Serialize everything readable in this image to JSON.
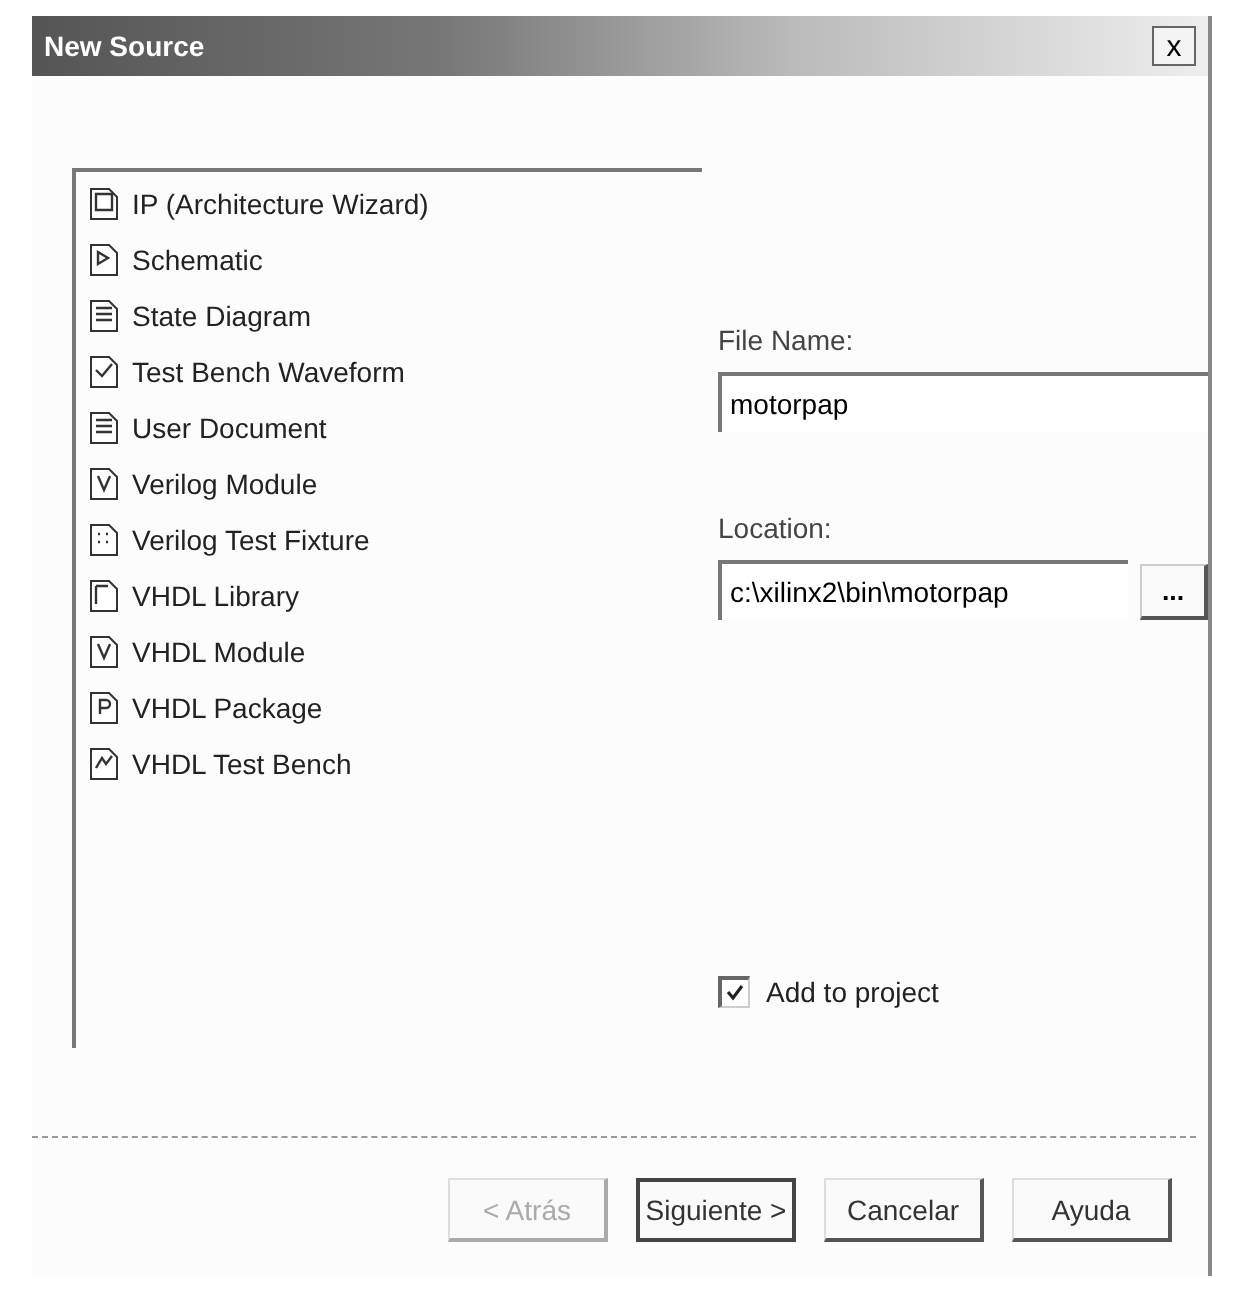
{
  "window": {
    "title": "New Source",
    "close": "x"
  },
  "source_types": [
    {
      "label": "IP (Architecture Wizard)",
      "kind": "ip"
    },
    {
      "label": "Schematic",
      "kind": "schematic"
    },
    {
      "label": "State Diagram",
      "kind": "lines"
    },
    {
      "label": "Test Bench Waveform",
      "kind": "check"
    },
    {
      "label": "User Document",
      "kind": "lines"
    },
    {
      "label": "Verilog Module",
      "kind": "v"
    },
    {
      "label": "Verilog Test Fixture",
      "kind": "dots"
    },
    {
      "label": "VHDL Library",
      "kind": "library"
    },
    {
      "label": "VHDL Module",
      "kind": "v"
    },
    {
      "label": "VHDL Package",
      "kind": "p"
    },
    {
      "label": "VHDL Test Bench",
      "kind": "bench"
    }
  ],
  "file_name": {
    "label": "File Name:",
    "value": "motorpap"
  },
  "location": {
    "label": "Location:",
    "value": "c:\\xilinx2\\bin\\motorpap",
    "browse": "..."
  },
  "add_to_project": {
    "label": "Add to project",
    "checked": true
  },
  "buttons": [
    {
      "label": "< Atrás",
      "disabled": true,
      "default": false
    },
    {
      "label": "Siguiente >",
      "disabled": false,
      "default": true
    },
    {
      "label": "Cancelar",
      "disabled": false,
      "default": false
    },
    {
      "label": "Ayuda",
      "disabled": false,
      "default": false
    }
  ]
}
